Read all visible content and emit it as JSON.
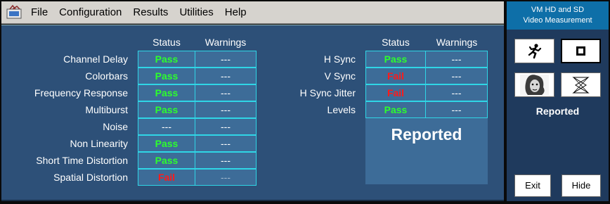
{
  "menu": {
    "items": [
      "File",
      "Configuration",
      "Results",
      "Utilities",
      "Help"
    ]
  },
  "left_table": {
    "headers": {
      "status": "Status",
      "warnings": "Warnings"
    },
    "rows": [
      {
        "label": "Channel Delay",
        "status": "Pass",
        "warnings": "---"
      },
      {
        "label": "Colorbars",
        "status": "Pass",
        "warnings": "---"
      },
      {
        "label": "Frequency Response",
        "status": "Pass",
        "warnings": "---"
      },
      {
        "label": "Multiburst",
        "status": "Pass",
        "warnings": "---"
      },
      {
        "label": "Noise",
        "status": "---",
        "warnings": "---"
      },
      {
        "label": "Non Linearity",
        "status": "Pass",
        "warnings": "---"
      },
      {
        "label": "Short Time Distortion",
        "status": "Pass",
        "warnings": "---"
      },
      {
        "label": "Spatial Distortion",
        "status": "Fail",
        "warnings": "---"
      }
    ]
  },
  "right_table": {
    "headers": {
      "status": "Status",
      "warnings": "Warnings"
    },
    "rows": [
      {
        "label": "H Sync",
        "status": "Pass",
        "warnings": "---"
      },
      {
        "label": "V Sync",
        "status": "Fail",
        "warnings": "---"
      },
      {
        "label": "H Sync Jitter",
        "status": "Fail",
        "warnings": "---"
      },
      {
        "label": "Levels",
        "status": "Pass",
        "warnings": "---"
      }
    ],
    "reported": "Reported"
  },
  "side_panel": {
    "title_line1": "VM HD and SD",
    "title_line2": "Video Measurement",
    "reported": "Reported",
    "exit_label": "Exit",
    "hide_label": "Hide"
  },
  "colors": {
    "pass": "#2dff2d",
    "fail": "#ff1a1a",
    "panel_bg": "#2d5078",
    "cell_bg": "#3d6c98",
    "cell_border": "#2fd6e6"
  }
}
